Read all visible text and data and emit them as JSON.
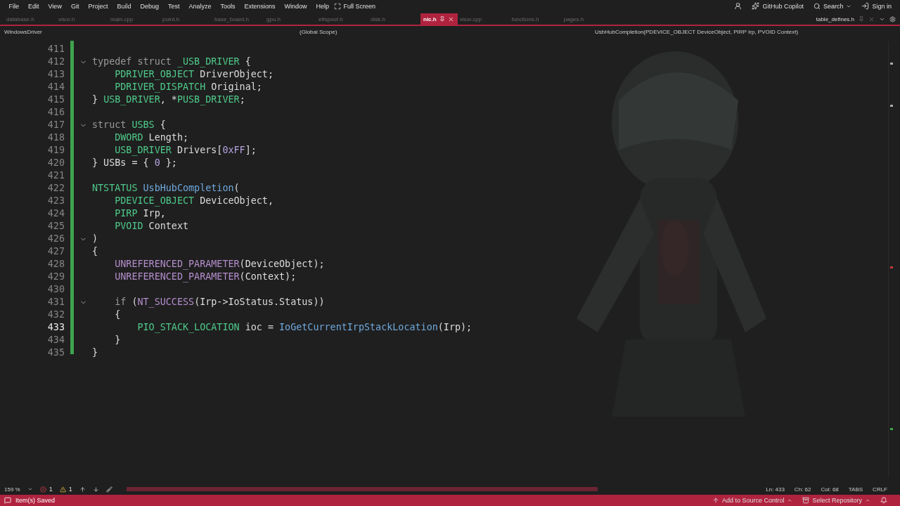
{
  "menu": [
    "File",
    "Edit",
    "View",
    "Git",
    "Project",
    "Build",
    "Debug",
    "Test",
    "Analyze",
    "Tools",
    "Extensions",
    "Window",
    "Help"
  ],
  "full_screen": "Full Screen",
  "copilot": "GitHub Copilot",
  "search": "Search",
  "sign_in": "Sign in",
  "tabs": [
    {
      "label": "database.h",
      "selected": false
    },
    {
      "label": "visor.h",
      "selected": false
    },
    {
      "label": "main.cpp",
      "selected": false
    },
    {
      "label": "point.h",
      "selected": false
    },
    {
      "label": "base_board.h",
      "selected": false
    },
    {
      "label": "gpu.h",
      "selected": false
    },
    {
      "label": "efispoof.h",
      "selected": false
    },
    {
      "label": "disk.h",
      "selected": false
    },
    {
      "label": "nic.h",
      "selected": true
    },
    {
      "label": "visor.cpp",
      "selected": false
    },
    {
      "label": "functions.h",
      "selected": false
    },
    {
      "label": "pages.h",
      "selected": false
    }
  ],
  "pinned_tab": "table_defines.h",
  "nav": {
    "project": "WindowsDriver",
    "scope": "(Global Scope)",
    "member": "UsbHubCompletion(PDEVICE_OBJECT DeviceObject, PIRP Irp, PVOID Context)"
  },
  "lines": [
    {
      "number": "411",
      "current": false
    },
    {
      "number": "412",
      "fold": true,
      "current": false,
      "tokens": [
        {
          "kind": "kw",
          "text": "typedef struct "
        },
        {
          "kind": "type",
          "text": "_USB_DRIVER"
        },
        {
          "kind": "plain",
          "text": " {"
        }
      ]
    },
    {
      "number": "413",
      "current": false,
      "tokens": [
        {
          "kind": "type",
          "text": "    PDRIVER_OBJECT"
        },
        {
          "kind": "plain",
          "text": " DriverObject;"
        }
      ]
    },
    {
      "number": "414",
      "current": false,
      "tokens": [
        {
          "kind": "type",
          "text": "    PDRIVER_DISPATCH"
        },
        {
          "kind": "plain",
          "text": " Original;"
        }
      ]
    },
    {
      "number": "415",
      "current": false,
      "tokens": [
        {
          "kind": "plain",
          "text": "} "
        },
        {
          "kind": "type",
          "text": "USB_DRIVER"
        },
        {
          "kind": "plain",
          "text": ", *"
        },
        {
          "kind": "type",
          "text": "PUSB_DRIVER"
        },
        {
          "kind": "plain",
          "text": ";"
        }
      ]
    },
    {
      "number": "416",
      "current": false
    },
    {
      "number": "417",
      "fold": true,
      "current": false,
      "tokens": [
        {
          "kind": "kw",
          "text": "struct "
        },
        {
          "kind": "type",
          "text": "USBS"
        },
        {
          "kind": "plain",
          "text": " {"
        }
      ]
    },
    {
      "number": "418",
      "current": false,
      "tokens": [
        {
          "kind": "type",
          "text": "    DWORD"
        },
        {
          "kind": "plain",
          "text": " Length;"
        }
      ]
    },
    {
      "number": "419",
      "current": false,
      "tokens": [
        {
          "kind": "type",
          "text": "    USB_DRIVER"
        },
        {
          "kind": "plain",
          "text": " Drivers["
        },
        {
          "kind": "num",
          "text": "0xFF"
        },
        {
          "kind": "plain",
          "text": "];"
        }
      ]
    },
    {
      "number": "420",
      "current": false,
      "tokens": [
        {
          "kind": "plain",
          "text": "} USBs = { "
        },
        {
          "kind": "num",
          "text": "0"
        },
        {
          "kind": "plain",
          "text": " };"
        }
      ]
    },
    {
      "number": "421",
      "current": false
    },
    {
      "number": "422",
      "current": false,
      "tokens": [
        {
          "kind": "type",
          "text": "NTSTATUS"
        },
        {
          "kind": "fn",
          "text": " UsbHubCompletion"
        },
        {
          "kind": "plain",
          "text": "("
        }
      ]
    },
    {
      "number": "423",
      "current": false,
      "tokens": [
        {
          "kind": "type",
          "text": "    PDEVICE_OBJECT"
        },
        {
          "kind": "plain",
          "text": " DeviceObject,"
        }
      ]
    },
    {
      "number": "424",
      "current": false,
      "tokens": [
        {
          "kind": "type",
          "text": "    PIRP"
        },
        {
          "kind": "plain",
          "text": " Irp,"
        }
      ]
    },
    {
      "number": "425",
      "current": false,
      "tokens": [
        {
          "kind": "type",
          "text": "    PVOID"
        },
        {
          "kind": "plain",
          "text": " Context"
        }
      ]
    },
    {
      "number": "426",
      "fold": true,
      "current": false,
      "tokens": [
        {
          "kind": "plain",
          "text": ")"
        }
      ]
    },
    {
      "number": "427",
      "current": false,
      "tokens": [
        {
          "kind": "plain",
          "text": "{"
        }
      ]
    },
    {
      "number": "428",
      "current": false,
      "tokens": [
        {
          "kind": "macro",
          "text": "    UNREFERENCED_PARAMETER"
        },
        {
          "kind": "plain",
          "text": "(DeviceObject);"
        }
      ]
    },
    {
      "number": "429",
      "current": false,
      "tokens": [
        {
          "kind": "macro",
          "text": "    UNREFERENCED_PARAMETER"
        },
        {
          "kind": "plain",
          "text": "(Context);"
        }
      ]
    },
    {
      "number": "430",
      "current": false
    },
    {
      "number": "431",
      "fold": true,
      "current": false,
      "tokens": [
        {
          "kind": "kw",
          "text": "    if"
        },
        {
          "kind": "plain",
          "text": " ("
        },
        {
          "kind": "macro",
          "text": "NT_SUCCESS"
        },
        {
          "kind": "plain",
          "text": "(Irp->IoStatus.Status))"
        }
      ]
    },
    {
      "number": "432",
      "current": false,
      "tokens": [
        {
          "kind": "plain",
          "text": "    {"
        }
      ]
    },
    {
      "number": "433",
      "current": true,
      "tokens": [
        {
          "kind": "type",
          "text": "        PIO_STACK_LOCATION"
        },
        {
          "kind": "plain",
          "text": " ioc = "
        },
        {
          "kind": "fn",
          "text": "IoGetCurrentIrpStackLocation"
        },
        {
          "kind": "plain",
          "text": "(Irp);"
        }
      ]
    },
    {
      "number": "434",
      "current": false,
      "tokens": [
        {
          "kind": "plain",
          "text": "    }"
        }
      ]
    },
    {
      "number": "435",
      "current": false,
      "tokens": [
        {
          "kind": "plain",
          "text": "}"
        }
      ]
    }
  ],
  "editor_status": {
    "zoom": "159 %",
    "errors": "1",
    "warnings": "1",
    "ln": "Ln: 433",
    "ch": "Ch: 62",
    "col": "Col: 68",
    "tabs": "TABS",
    "eol": "CRLF"
  },
  "status_bar": {
    "message": "Item(s) Saved",
    "source_control": "Add to Source Control",
    "repository": "Select Repository"
  }
}
